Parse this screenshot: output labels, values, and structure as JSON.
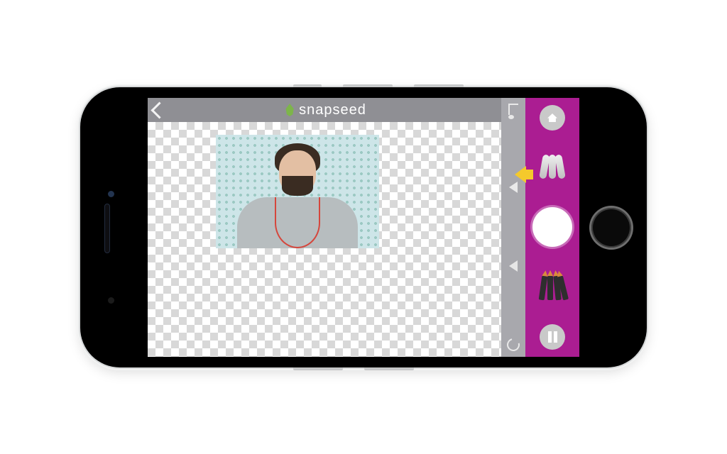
{
  "app": {
    "name": "snapseed"
  },
  "titlebar": {
    "back_label": "Back"
  },
  "canvas": {
    "has_transparency": true,
    "photo": {
      "description": "bearded man in grey shirt with red lanyard on dotted blue background"
    }
  },
  "midstrip": {
    "items": [
      {
        "name": "music-icon"
      },
      {
        "name": "nav-prev-icon"
      },
      {
        "name": "nav-next-icon"
      },
      {
        "name": "loop-icon"
      }
    ]
  },
  "dock": {
    "accent": "#ab1d92",
    "pointer": "#f4c92c",
    "home_label": "Home",
    "brush_label": "Brush",
    "shutter_label": "Capture",
    "pencils_label": "Draw",
    "pause_label": "Pause"
  }
}
